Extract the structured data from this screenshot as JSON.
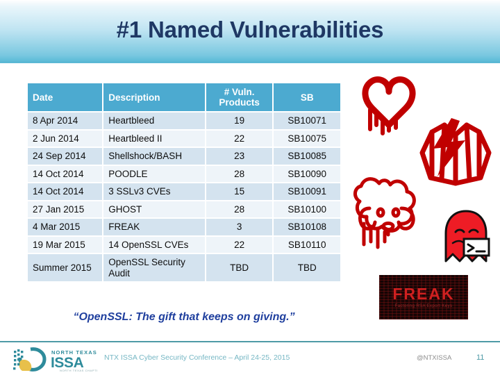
{
  "slide": {
    "title": "#1 Named Vulnerabilities",
    "quote": "“OpenSSL: The gift that keeps on giving.”"
  },
  "table": {
    "columns": [
      {
        "key": "date",
        "label": "Date"
      },
      {
        "key": "desc",
        "label": "Description"
      },
      {
        "key": "count",
        "label": "# Vuln. Products"
      },
      {
        "key": "sb",
        "label": "SB"
      }
    ],
    "count_header_line1": "# Vuln.",
    "count_header_line2": "Products",
    "rows": [
      {
        "date": "8 Apr 2014",
        "desc": "Heartbleed",
        "desc_red": true,
        "count": "19",
        "sb": "SB10071"
      },
      {
        "date": "2 Jun 2014",
        "desc": "Heartbleed II",
        "desc_red": true,
        "count": "22",
        "sb": "SB10075"
      },
      {
        "date": "24 Sep 2014",
        "desc": "Shellshock/BASH",
        "desc_red": true,
        "count": "23",
        "sb": "SB10085"
      },
      {
        "date": "14 Oct 2014",
        "desc": "POODLE",
        "desc_red": true,
        "count": "28",
        "sb": "SB10090"
      },
      {
        "date": "14 Oct 2014",
        "desc": "3 SSLv3 CVEs",
        "desc_red": false,
        "count": "15",
        "sb": "SB10091"
      },
      {
        "date": "27 Jan 2015",
        "desc": "GHOST",
        "desc_red": true,
        "count": "28",
        "sb": "SB10100"
      },
      {
        "date": "4 Mar 2015",
        "desc": "FREAK",
        "desc_red": true,
        "count": "3",
        "sb": "SB10108"
      },
      {
        "date": "19 Mar 2015",
        "desc": "14 OpenSSL CVEs",
        "desc_red": false,
        "count": "22",
        "sb": "SB10110"
      },
      {
        "date": "Summer 2015",
        "desc": "OpenSSL Security Audit",
        "desc_red": true,
        "count": "TBD",
        "sb": "TBD"
      }
    ]
  },
  "logos": [
    {
      "name": "heartbleed-logo",
      "alt": "Heartbleed bleeding heart"
    },
    {
      "name": "shellshock-logo",
      "alt": "Shellshock shell with lightning bolt"
    },
    {
      "name": "poodle-logo",
      "alt": "POODLE bleeding poodle"
    },
    {
      "name": "ghost-logo",
      "alt": "GHOST ghost holding terminal prompt"
    },
    {
      "name": "freak-logo",
      "alt": "FREAK banner"
    }
  ],
  "freak": {
    "word": "FREAK",
    "subtitle": "Factoring RSA Export Keys"
  },
  "footer": {
    "logo_top": "NORTH TEXAS",
    "logo_main": "ISSA",
    "logo_sub": "NORTH TEXAS CHAPTER",
    "center": "NTX ISSA Cyber Security Conference – April 24-25, 2015",
    "handle": "@NTXISSA",
    "page": "11"
  },
  "colors": {
    "title_text": "#1F3864",
    "table_header_bg": "#4CAAD0",
    "row_alt_bg": "#D4E3EF",
    "row_plain_bg": "#EEF4F9",
    "red_text": "#C00000",
    "quote_text": "#1F3F9E",
    "footer_rule": "#4E9AA6",
    "footer_text": "#76B7C4",
    "logo_teal": "#2E8B9B"
  }
}
